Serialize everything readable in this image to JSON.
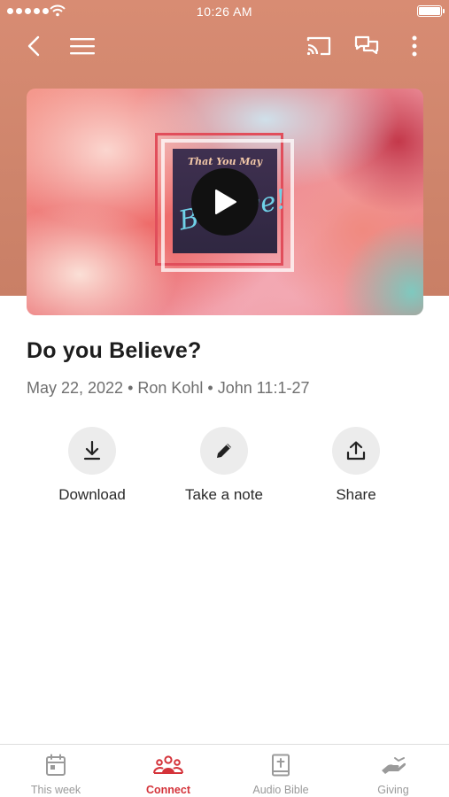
{
  "status_bar": {
    "time": "10:26 AM"
  },
  "colors": {
    "header": "#d88c73",
    "accent": "#d4333a",
    "inactive": "#9a9a9a"
  },
  "nav": {
    "back_icon": "chevron-left-icon",
    "menu_icon": "hamburger-menu-icon",
    "cast_icon": "cast-icon",
    "chat_icon": "chat-bubbles-icon",
    "more_icon": "more-vertical-icon"
  },
  "video": {
    "album_title": "That You May",
    "album_script": "Believe!",
    "play_icon": "play-icon"
  },
  "sermon": {
    "title": "Do you Believe?",
    "meta": "May 22, 2022 • Ron Kohl • John 11:1-27"
  },
  "actions": [
    {
      "label": "Download",
      "icon": "download-icon"
    },
    {
      "label": "Take a note",
      "icon": "pencil-icon"
    },
    {
      "label": "Share",
      "icon": "share-upload-icon"
    }
  ],
  "tabs": [
    {
      "label": "This week",
      "icon": "calendar-icon",
      "active": false
    },
    {
      "label": "Connect",
      "icon": "people-group-icon",
      "active": true
    },
    {
      "label": "Audio Bible",
      "icon": "bible-icon",
      "active": false
    },
    {
      "label": "Giving",
      "icon": "giving-hand-icon",
      "active": false
    }
  ]
}
